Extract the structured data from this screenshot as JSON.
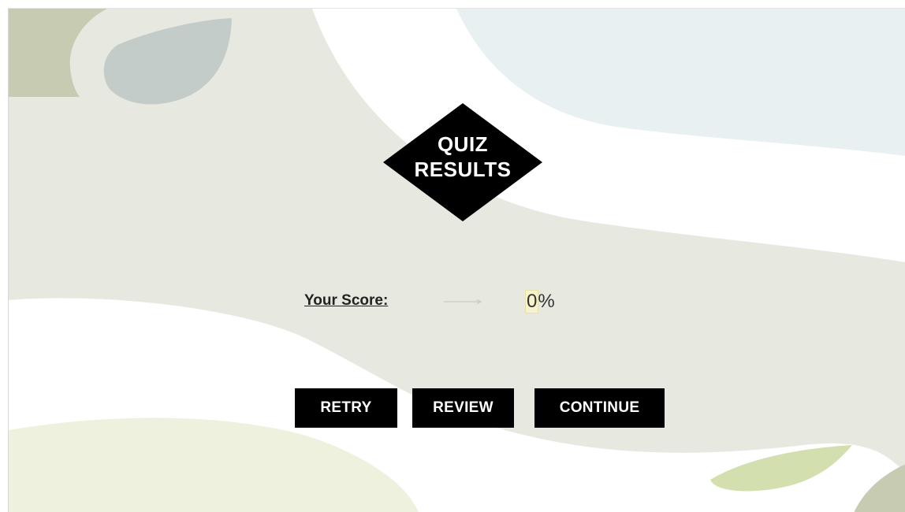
{
  "badge": {
    "line1": "QUIZ",
    "line2": "RESULTS"
  },
  "score": {
    "label": "Your Score:",
    "value": "0",
    "unit": "%"
  },
  "buttons": {
    "retry": "RETRY",
    "review": "REVIEW",
    "continue": "CONTINUE"
  },
  "colors": {
    "background_sage": "#e7e9e1",
    "background_white": "#ffffff",
    "background_blue": "#e8f0f1",
    "leaf_olive": "#c6cbb1",
    "leaf_grey_blue": "#c3ccc8",
    "leaf_light_green": "#d4dfb0",
    "button_black": "#000000",
    "button_text": "#ffffff"
  }
}
